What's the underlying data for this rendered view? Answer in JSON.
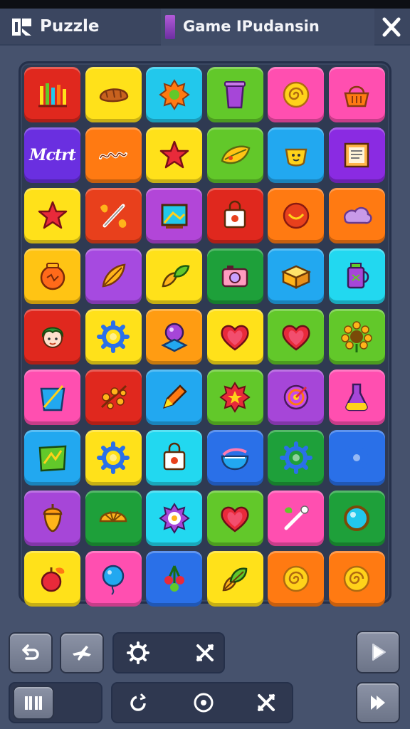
{
  "header": {
    "app_title": "Puzzle",
    "tab_title": "Game IPudansin",
    "app_icon": "puzzle-logo-icon",
    "close_icon": "close-icon"
  },
  "board": {
    "rows": [
      [
        {
          "color": "#e0281e",
          "icon": "bar-graph"
        },
        {
          "color": "#ffe11a",
          "icon": "bread"
        },
        {
          "color": "#22c8ec",
          "icon": "gear-flower"
        },
        {
          "color": "#62c82a",
          "icon": "cup"
        },
        {
          "color": "#ff4fb0",
          "icon": "spiral"
        },
        {
          "color": "#ff4fb0",
          "icon": "basket"
        }
      ],
      [
        {
          "color": "#6a2fe0",
          "icon": "text",
          "text": "Mctrt"
        },
        {
          "color": "#ff7a12",
          "icon": "squiggle"
        },
        {
          "color": "#ffe11a",
          "icon": "star"
        },
        {
          "color": "#62c82a",
          "icon": "leaf"
        },
        {
          "color": "#22a8f0",
          "icon": "teacup"
        },
        {
          "color": "#8a2be2",
          "icon": "frame"
        }
      ],
      [
        {
          "color": "#ffe11a",
          "icon": "star"
        },
        {
          "color": "#e8401c",
          "icon": "percent"
        },
        {
          "color": "#b246d8",
          "icon": "picture"
        },
        {
          "color": "#e0281e",
          "icon": "bag"
        },
        {
          "color": "#ff7a12",
          "icon": "smile"
        },
        {
          "color": "#ff7a12",
          "icon": "cloud"
        }
      ],
      [
        {
          "color": "#ffc414",
          "icon": "pot"
        },
        {
          "color": "#a64ae0",
          "icon": "leaf-brush"
        },
        {
          "color": "#ffe11a",
          "icon": "leaves"
        },
        {
          "color": "#1ea03a",
          "icon": "camera"
        },
        {
          "color": "#22a8f0",
          "icon": "box"
        },
        {
          "color": "#22d8f0",
          "icon": "lantern"
        }
      ],
      [
        {
          "color": "#e0281e",
          "icon": "face"
        },
        {
          "color": "#ffe11a",
          "icon": "gear"
        },
        {
          "color": "#ff9c12",
          "icon": "crystal-ball"
        },
        {
          "color": "#ffe11a",
          "icon": "heart"
        },
        {
          "color": "#62c82a",
          "icon": "heart"
        },
        {
          "color": "#62c82a",
          "icon": "sunflower"
        }
      ],
      [
        {
          "color": "#ff4fb0",
          "icon": "bucket"
        },
        {
          "color": "#e0281e",
          "icon": "branches"
        },
        {
          "color": "#22a8f0",
          "icon": "pencil"
        },
        {
          "color": "#62c82a",
          "icon": "badge"
        },
        {
          "color": "#a646d8",
          "icon": "target"
        },
        {
          "color": "#ff4fb0",
          "icon": "flask"
        }
      ],
      [
        {
          "color": "#22a8f0",
          "icon": "map"
        },
        {
          "color": "#ffe11a",
          "icon": "gear"
        },
        {
          "color": "#22d8f0",
          "icon": "bag"
        },
        {
          "color": "#2a70e8",
          "icon": "bowl"
        },
        {
          "color": "#1ea03a",
          "icon": "gear"
        },
        {
          "color": "#2a70e8",
          "icon": "gear"
        }
      ],
      [
        {
          "color": "#a646d8",
          "icon": "acorn"
        },
        {
          "color": "#1ea03a",
          "icon": "orange"
        },
        {
          "color": "#22d8f0",
          "icon": "rosette"
        },
        {
          "color": "#62c82a",
          "icon": "heart"
        },
        {
          "color": "#ff4fb0",
          "icon": "wand"
        },
        {
          "color": "#1ea03a",
          "icon": "orb"
        }
      ],
      [
        {
          "color": "#ffe11a",
          "icon": "apple"
        },
        {
          "color": "#ff4fb0",
          "icon": "balloon"
        },
        {
          "color": "#2a70e8",
          "icon": "cherries"
        },
        {
          "color": "#ffe11a",
          "icon": "leaf-bunch"
        },
        {
          "color": "#ff7a12",
          "icon": "spiral"
        },
        {
          "color": "#ff7a12",
          "icon": "spiral"
        }
      ]
    ]
  },
  "controls": {
    "row1": [
      "undo-icon",
      "plane-icon",
      "gear-icon",
      "crossed-swords-icon",
      "play-icon"
    ],
    "row2": [
      "book-icon",
      "rotate-icon",
      "record-icon",
      "crossed-swords-icon",
      "skip-icon"
    ]
  }
}
